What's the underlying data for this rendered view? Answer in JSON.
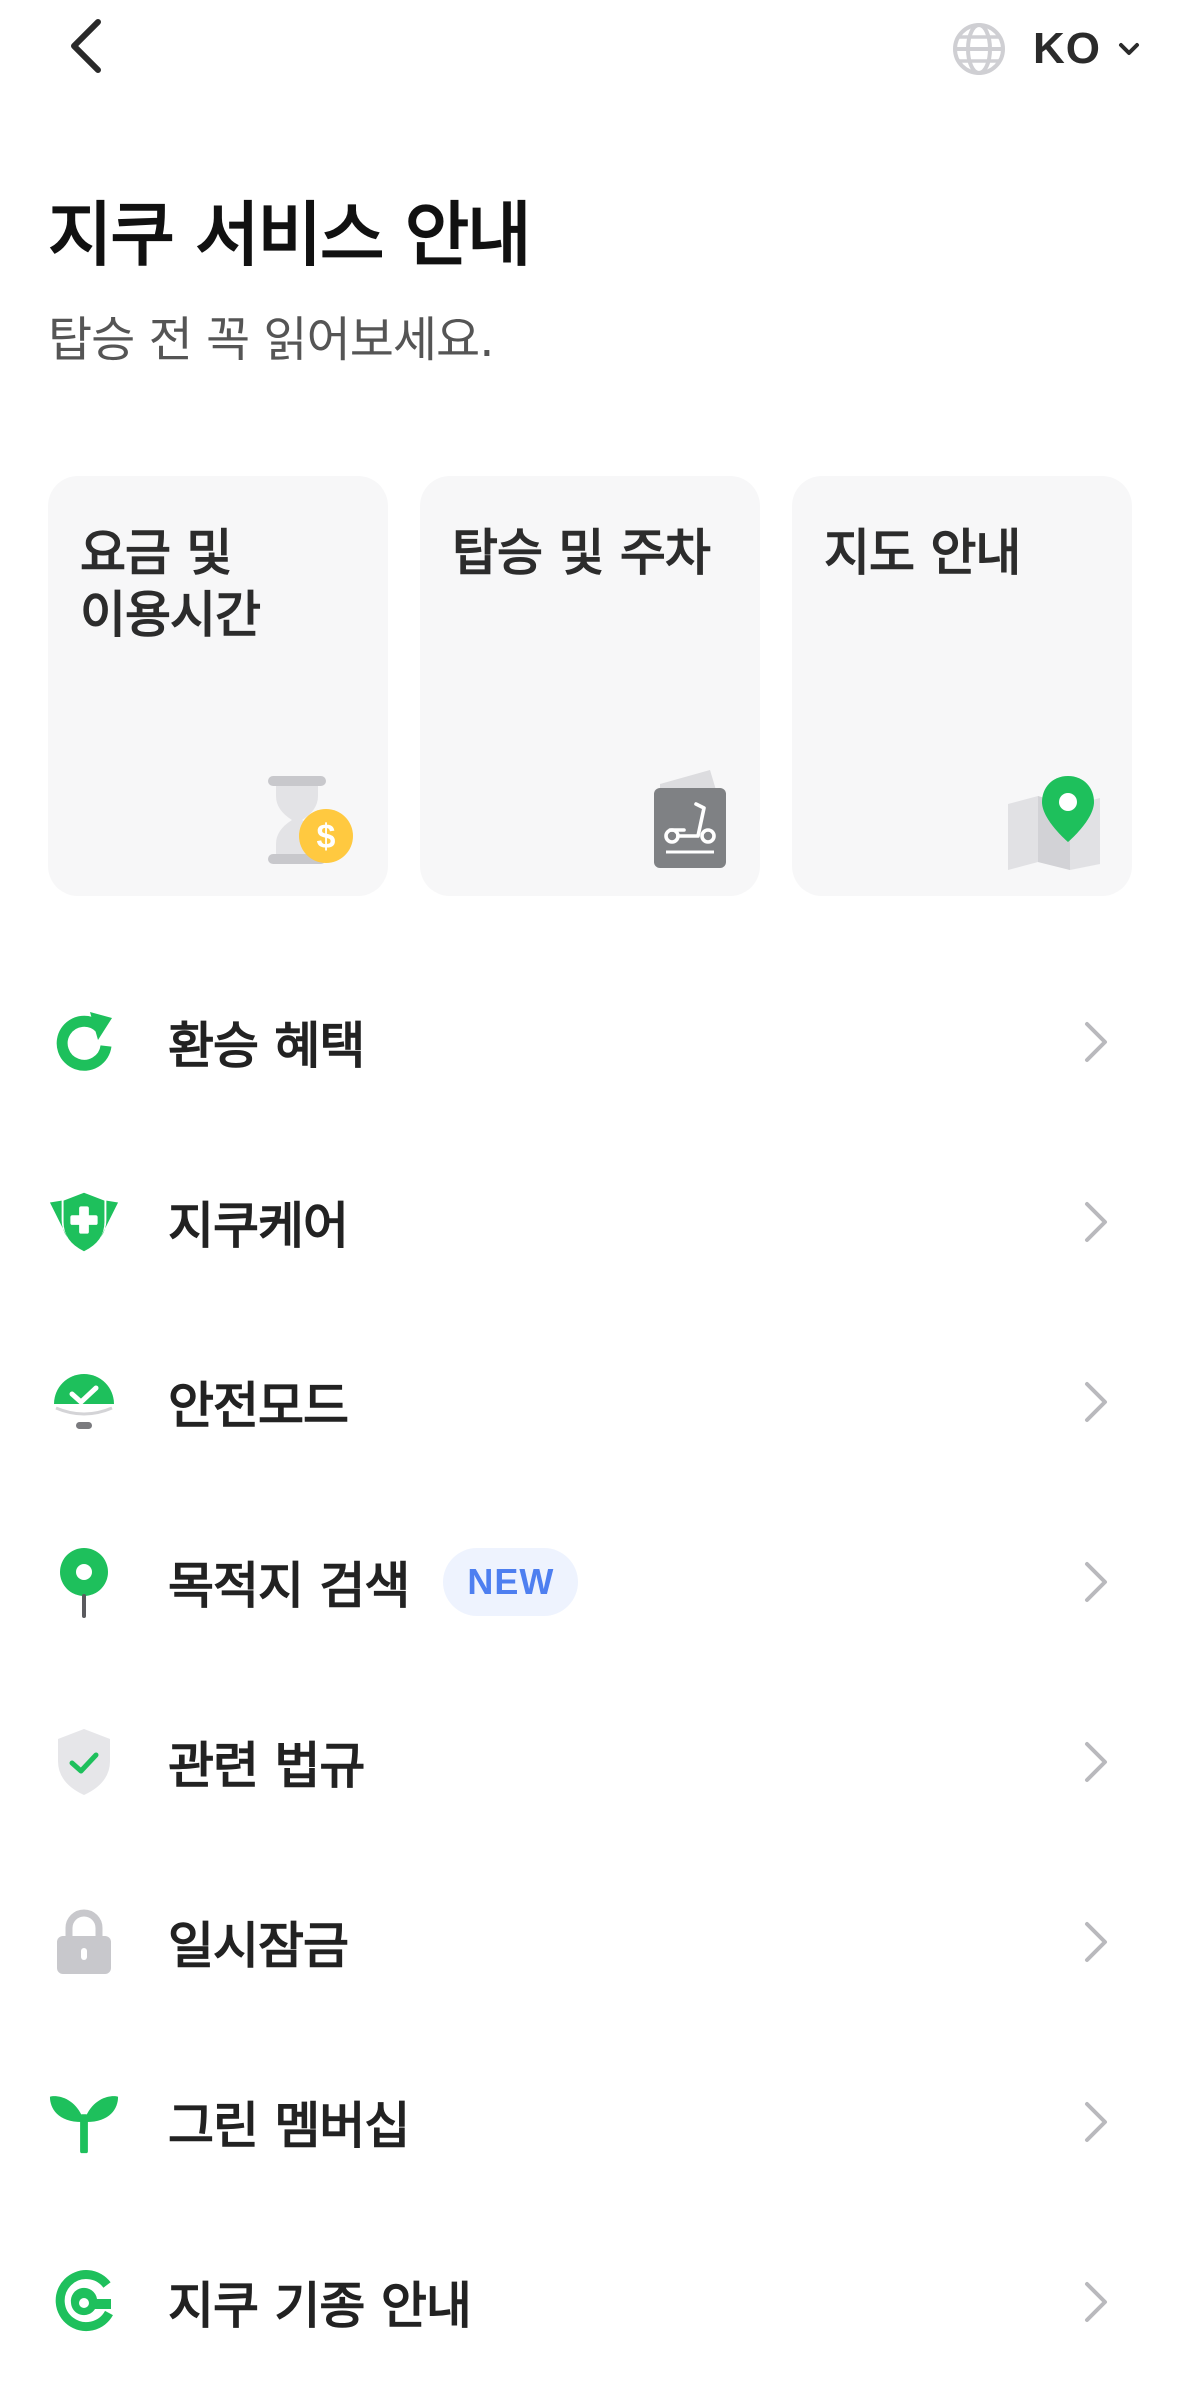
{
  "header": {
    "back_icon": "chevron-left-icon",
    "language": {
      "globe_icon": "globe-icon",
      "code": "KO",
      "chevron_icon": "chevron-down-icon"
    }
  },
  "title": "지쿠 서비스 안내",
  "subtitle": "탑승 전 꼭 읽어보세요.",
  "cards": [
    {
      "label": "요금 및\n이용시간",
      "icon": "hourglass-coin-icon"
    },
    {
      "label": "탑승 및 주차",
      "icon": "scooter-card-icon"
    },
    {
      "label": "지도 안내",
      "icon": "map-pin-icon"
    }
  ],
  "list": [
    {
      "label": "환승 혜택",
      "icon": "refresh-icon"
    },
    {
      "label": "지쿠케어",
      "icon": "shield-cross-icon"
    },
    {
      "label": "안전모드",
      "icon": "helmet-check-icon"
    },
    {
      "label": "목적지 검색",
      "icon": "location-pin-icon",
      "badge": "NEW"
    },
    {
      "label": "관련 법규",
      "icon": "shield-check-icon"
    },
    {
      "label": "일시잠금",
      "icon": "lock-icon"
    },
    {
      "label": "그린 멤버십",
      "icon": "sprout-icon"
    },
    {
      "label": "지쿠 기종 안내",
      "icon": "scooter-logo-icon"
    }
  ],
  "colors": {
    "accent_green": "#1ec05c",
    "badge_blue": "#4e7ff0",
    "badge_bg": "#eef3fe",
    "card_bg": "#f7f7f8",
    "icon_gray": "#c8c8cc"
  }
}
